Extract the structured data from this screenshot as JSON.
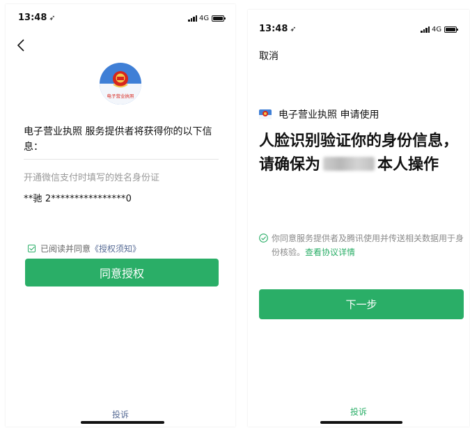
{
  "left": {
    "status": {
      "time": "13:48",
      "network": "4G"
    },
    "emblem_text": "电子营业执照",
    "auth_intro": "电子营业执照 服务提供者将获得你的以下信息：",
    "auth_item": {
      "label": "开通微信支付时填写的姓名身份证",
      "value": "**驰 2****************0"
    },
    "agreement": {
      "prefix": "已阅读并同意",
      "link": "《授权须知》",
      "checked": true
    },
    "agree_button": "同意授权",
    "complain": "投诉"
  },
  "right": {
    "status": {
      "time": "13:48",
      "network": "4G"
    },
    "cancel": "取消",
    "app_request": "电子营业执照 申请使用",
    "headline_pre": "人脸识别验证你的身份信息，请确保为",
    "headline_post": "本人操作",
    "consent_text": "你同意服务提供者及腾讯使用并传送相关数据用于身份核验。",
    "consent_link": "查看协议详情",
    "next_button": "下一步",
    "complain": "投诉"
  },
  "colors": {
    "primary_green": "#2aae67",
    "link_blue": "#576b95",
    "emblem_red": "#d7261c",
    "emblem_blue": "#3f7fd6"
  }
}
